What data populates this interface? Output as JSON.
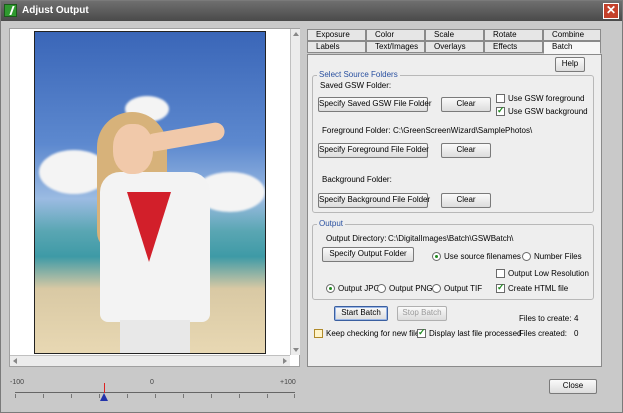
{
  "window": {
    "title": "Adjust Output"
  },
  "slider": {
    "min_label": "-100",
    "mid_label": "0",
    "max_label": "+100"
  },
  "tabs": {
    "row1": [
      "Exposure",
      "Color",
      "Scale",
      "Rotate",
      "Combine"
    ],
    "row2": [
      "Labels",
      "Text/Images",
      "Overlays",
      "Effects",
      "Batch"
    ],
    "active": "Batch"
  },
  "batch": {
    "help_label": "Help",
    "source": {
      "group_title": "Select Source Folders",
      "saved_gsw_label": "Saved GSW Folder:",
      "specify_saved_btn": "Specify Saved GSW File Folder",
      "clear_label": "Clear",
      "use_gsw_foreground": "Use GSW foreground",
      "use_gsw_background": "Use GSW background",
      "foreground_label": "Foreground Folder:",
      "foreground_path": "C:\\GreenScreenWizard\\SamplePhotos\\",
      "specify_foreground_btn": "Specify Foreground File Folder",
      "background_label": "Background Folder:",
      "specify_background_btn": "Specify Background File Folder"
    },
    "output": {
      "group_title": "Output",
      "directory_label": "Output Directory:",
      "directory_path": "C:\\DigitalImages\\Batch\\GSWBatch\\",
      "specify_output_btn": "Specify Output Folder",
      "use_source_filenames": "Use source filenames",
      "number_files": "Number Files",
      "low_resolution": "Output Low Resolution",
      "output_jpg": "Output JPG",
      "output_png": "Output PNG",
      "output_tif": "Output TIF",
      "create_html": "Create HTML file"
    },
    "start_batch": "Start Batch",
    "stop_batch": "Stop Batch",
    "keep_checking": "Keep checking for new files",
    "display_last": "Display last file processed",
    "files_to_create_label": "Files to create:",
    "files_to_create": "4",
    "files_created_label": "Files created:",
    "files_created": "0"
  },
  "close_label": "Close"
}
